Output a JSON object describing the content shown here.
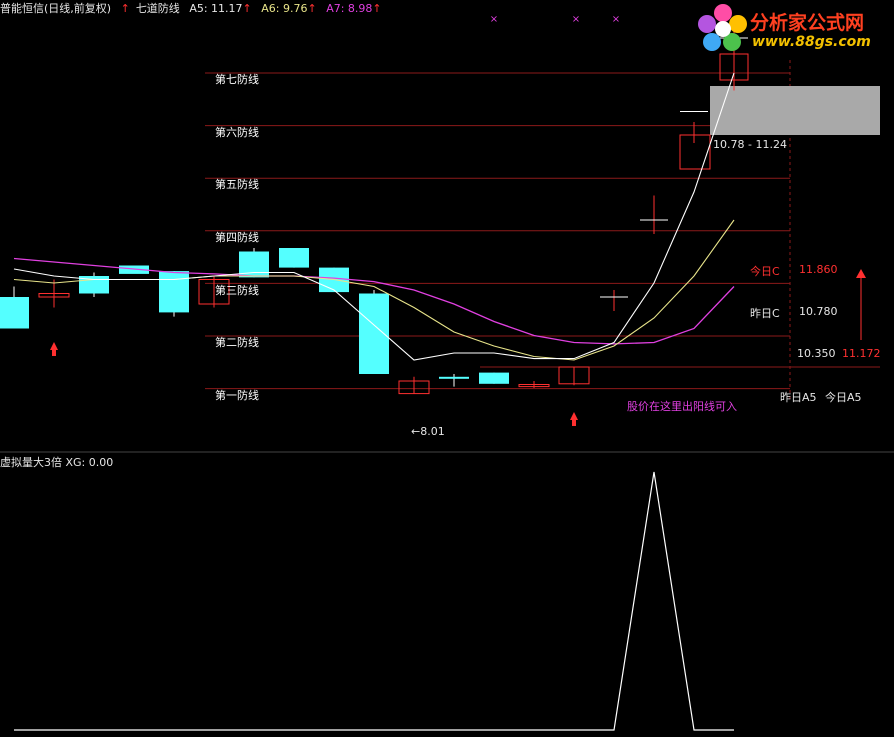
{
  "header": {
    "title": "普能恒信(日线,前复权)",
    "indicator": "七道防线",
    "a5": "A5: 11.17",
    "a6": "A6: 9.76",
    "a7": "A7: 8.98"
  },
  "defense_lines": [
    "第七防线",
    "第六防线",
    "第五防线",
    "第四防线",
    "第三防线",
    "第二防线",
    "第一防线"
  ],
  "annotations": {
    "range": "10.78 - 11.24",
    "today_c_label": "今日C",
    "today_c_value": "11.860",
    "yesterday_c_label": "昨日C",
    "yesterday_c_value": "10.780",
    "a5_value": "10.350",
    "a5_today_value": "11.172",
    "yesterday_a5": "昨日A5",
    "today_a5": "今日A5",
    "buy_hint": "股价在这里出阳线可入",
    "low_marker": "←8.01"
  },
  "sub_panel": {
    "title": "虚拟量大3倍",
    "xg": "XG: 0.00"
  },
  "logo": {
    "title": "分析家公式网",
    "url": "www.88gs.com"
  },
  "colors": {
    "up": "#ff3030",
    "down": "#54ffff",
    "ma_white": "#ffffff",
    "ma_yellow": "#e8e48a",
    "ma_magenta": "#e040e0",
    "grid": "#8b1a1a"
  },
  "chart_data": {
    "type": "candlestick",
    "candles": [
      {
        "o": 10.0,
        "h": 10.15,
        "l": 9.55,
        "c": 9.55
      },
      {
        "o": 10.0,
        "h": 10.25,
        "l": 9.85,
        "c": 10.05
      },
      {
        "o": 10.3,
        "h": 10.35,
        "l": 10.0,
        "c": 10.05
      },
      {
        "o": 10.45,
        "h": 10.45,
        "l": 10.35,
        "c": 10.33
      },
      {
        "o": 10.37,
        "h": 10.37,
        "l": 9.72,
        "c": 9.78
      },
      {
        "o": 9.9,
        "h": 10.3,
        "l": 9.85,
        "c": 10.25
      },
      {
        "o": 10.65,
        "h": 10.7,
        "l": 10.28,
        "c": 10.28
      },
      {
        "o": 10.7,
        "h": 10.7,
        "l": 10.42,
        "c": 10.42
      },
      {
        "o": 10.42,
        "h": 10.42,
        "l": 10.08,
        "c": 10.07
      },
      {
        "o": 10.05,
        "h": 10.1,
        "l": 8.9,
        "c": 8.9
      },
      {
        "o": 8.62,
        "h": 8.86,
        "l": 8.62,
        "c": 8.8
      },
      {
        "o": 8.86,
        "h": 8.9,
        "l": 8.72,
        "c": 8.85
      },
      {
        "o": 8.92,
        "h": 8.92,
        "l": 8.76,
        "c": 8.76
      },
      {
        "o": 8.72,
        "h": 8.8,
        "l": 8.7,
        "c": 8.75
      },
      {
        "o": 8.76,
        "h": 9.0,
        "l": 8.74,
        "c": 9.0
      },
      {
        "o": 10.0,
        "h": 10.1,
        "l": 9.8,
        "c": 10.0
      },
      {
        "o": 11.1,
        "h": 11.45,
        "l": 10.9,
        "c": 11.1
      },
      {
        "o": 12.2,
        "h": 12.5,
        "l": 12.2,
        "c": 12.65
      },
      {
        "o": 13.3,
        "h": 14.0,
        "l": 12.95,
        "c": 13.7
      }
    ],
    "ma_white": [
      10.4,
      10.3,
      10.25,
      10.25,
      10.25,
      10.3,
      10.35,
      10.35,
      10.1,
      9.6,
      9.1,
      9.2,
      9.2,
      9.12,
      9.12,
      9.35,
      10.2,
      11.5,
      13.2
    ],
    "ma_yellow": [
      10.25,
      10.2,
      10.25,
      10.25,
      10.25,
      10.3,
      10.3,
      10.3,
      10.25,
      10.15,
      9.85,
      9.5,
      9.3,
      9.15,
      9.1,
      9.3,
      9.7,
      10.3,
      11.1
    ],
    "ma_magenta": [
      10.55,
      10.5,
      10.45,
      10.4,
      10.35,
      10.33,
      10.3,
      10.3,
      10.27,
      10.22,
      10.1,
      9.9,
      9.65,
      9.45,
      9.35,
      9.33,
      9.35,
      9.55,
      10.15
    ],
    "defense_levels": [
      13.55,
      12.3,
      11.06,
      9.82,
      8.58,
      7.34,
      6.1
    ],
    "volume_signal": [
      0,
      0,
      0,
      0,
      0,
      0,
      0,
      0,
      0,
      0,
      0,
      0,
      0,
      0,
      0,
      0,
      1,
      0,
      0
    ],
    "price_range": [
      8.3,
      13.9
    ]
  }
}
